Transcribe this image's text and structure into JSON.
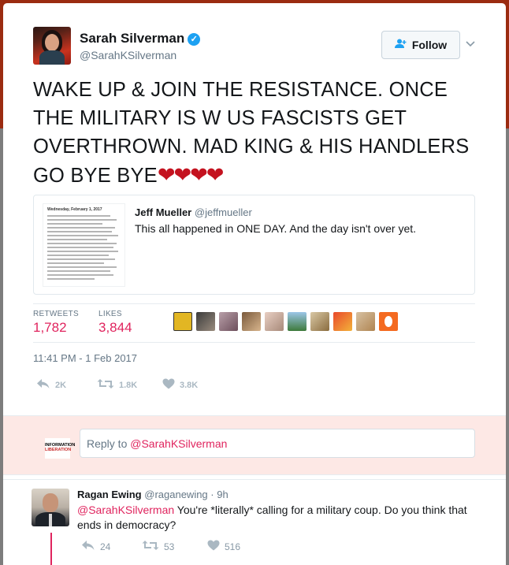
{
  "author": {
    "name": "Sarah Silverman",
    "handle": "@SarahKSilverman",
    "verified_mark": "✓"
  },
  "follow_button": {
    "label": "Follow",
    "icon": "follow-user-icon"
  },
  "tweet": {
    "text": "WAKE UP & JOIN THE RESISTANCE.  ONCE THE MILITARY IS W US FASCISTS GET OVERTHROWN. MAD KING & HIS HANDLERS GO BYE BYE",
    "emoji": "❤❤❤❤"
  },
  "quote": {
    "author_name": "Jeff Mueller",
    "author_handle": "@jeffmueller",
    "text": "This all happened in ONE DAY. And the day isn't over yet.",
    "thumb_title": "Wednesday, February 1, 2017"
  },
  "stats": {
    "retweets_label": "RETWEETS",
    "retweets_value": "1,782",
    "likes_label": "LIKES",
    "likes_value": "3,844"
  },
  "timestamp": "11:41 PM - 1 Feb 2017",
  "actions": {
    "reply_count": "2K",
    "retweet_count": "1.8K",
    "like_count": "3.8K"
  },
  "reply_box": {
    "avatar_line1": "INFORMATION",
    "avatar_line2": "LIBERATION",
    "placeholder_prefix": "Reply to ",
    "placeholder_mention": "@SarahKSilverman"
  },
  "reply_tweet": {
    "name": "Ragan Ewing",
    "handle": "@raganewing · 9h",
    "mention": "@SarahKSilverman",
    "text": " You're *literally* calling for a military coup. Do you think that ends in democracy?",
    "reply_count": "24",
    "retweet_count": "53",
    "like_count": "516"
  },
  "colors": {
    "accent": "#e0245e",
    "brand_blue": "#1da1f2",
    "top_background": "#9b2b10",
    "bottom_background": "#7d7d7d",
    "reply_area_background": "#fde8e5"
  }
}
